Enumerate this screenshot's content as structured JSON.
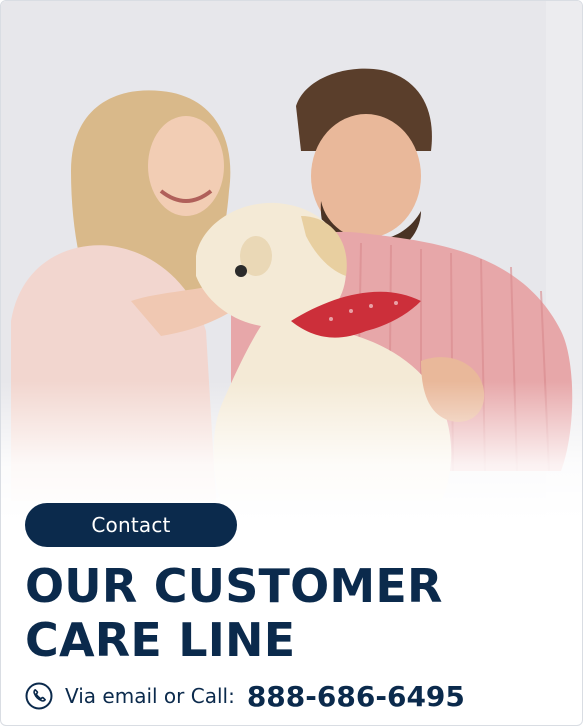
{
  "pill": {
    "label": "Contact"
  },
  "title": {
    "line1": "OUR CUSTOMER",
    "line2": "CARE LINE"
  },
  "contact": {
    "prefix": "Via email or Call:",
    "phone": "888-686-6495",
    "icon": "phone-icon"
  },
  "colors": {
    "primary": "#0b2a4c",
    "bandana": "#cc2f3a",
    "background": "#ffffff"
  },
  "photo": {
    "icon": "photo-couple-with-dog"
  }
}
